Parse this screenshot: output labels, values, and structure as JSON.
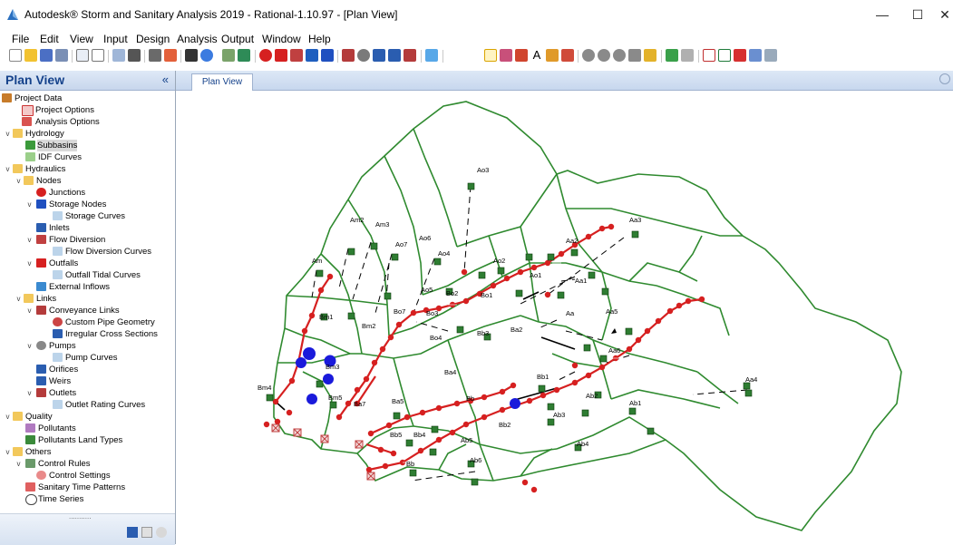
{
  "window": {
    "title": "Autodesk® Storm and Sanitary Analysis 2019 - Rational-1.10.97 - [Plan View]",
    "minimize_glyph": "—",
    "maximize_glyph": "☐",
    "close_glyph": "✕"
  },
  "menu": [
    "File",
    "Edit",
    "View",
    "Input",
    "Design",
    "Analysis",
    "Output",
    "Window",
    "Help"
  ],
  "panel": {
    "title": "Plan View",
    "collapse_glyph": "«",
    "footer_handle": "..........."
  },
  "tree": [
    {
      "label": "Project Data",
      "icon": "project-icon"
    },
    {
      "label": "Project Options",
      "icon": "options-icon"
    },
    {
      "label": "Analysis Options",
      "icon": "analysis-icon"
    },
    {
      "label": "Hydrology",
      "icon": "folder-icon"
    },
    {
      "label": "Subbasins",
      "icon": "subbasin-icon"
    },
    {
      "label": "IDF Curves",
      "icon": "curve-icon"
    },
    {
      "label": "Hydraulics",
      "icon": "folder-icon"
    },
    {
      "label": "Nodes",
      "icon": "folder-icon"
    },
    {
      "label": "Junctions",
      "icon": "junction-icon"
    },
    {
      "label": "Storage Nodes",
      "icon": "storage-icon"
    },
    {
      "label": "Storage Curves",
      "icon": "curve-icon"
    },
    {
      "label": "Inlets",
      "icon": "inlet-icon"
    },
    {
      "label": "Flow Diversion",
      "icon": "diversion-icon"
    },
    {
      "label": "Flow Diversion Curves",
      "icon": "curve-icon"
    },
    {
      "label": "Outfalls",
      "icon": "outfall-icon"
    },
    {
      "label": "Outfall Tidal Curves",
      "icon": "curve-icon"
    },
    {
      "label": "External Inflows",
      "icon": "inflow-icon"
    },
    {
      "label": "Links",
      "icon": "folder-icon"
    },
    {
      "label": "Conveyance Links",
      "icon": "pipe-icon"
    },
    {
      "label": "Custom Pipe Geometry",
      "icon": "pipe-geometry-icon"
    },
    {
      "label": "Irregular Cross Sections",
      "icon": "cross-section-icon"
    },
    {
      "label": "Pumps",
      "icon": "pump-icon"
    },
    {
      "label": "Pump Curves",
      "icon": "curve-icon"
    },
    {
      "label": "Orifices",
      "icon": "orifice-icon"
    },
    {
      "label": "Weirs",
      "icon": "weir-icon"
    },
    {
      "label": "Outlets",
      "icon": "outlet-icon"
    },
    {
      "label": "Outlet Rating Curves",
      "icon": "curve-icon"
    },
    {
      "label": "Quality",
      "icon": "folder-icon"
    },
    {
      "label": "Pollutants",
      "icon": "pollutant-icon"
    },
    {
      "label": "Pollutants Land Types",
      "icon": "landtype-icon"
    },
    {
      "label": "Others",
      "icon": "folder-icon"
    },
    {
      "label": "Control Rules",
      "icon": "rules-icon"
    },
    {
      "label": "Control Settings",
      "icon": "settings-icon"
    },
    {
      "label": "Sanitary Time Patterns",
      "icon": "pattern-icon"
    },
    {
      "label": "Time Series",
      "icon": "clock-icon"
    }
  ],
  "tabs": [
    "Plan View"
  ],
  "map": {
    "subbasin_labels": [
      "Ao3",
      "Am2",
      "Am3",
      "Ao7",
      "Ao6",
      "Ao4",
      "Ao2",
      "Ao1",
      "Aa3",
      "Aa2",
      "Am",
      "Ao5",
      "Bo2",
      "Bo1",
      "Aa1",
      "Aa5",
      "Bm1",
      "Bm2",
      "Bo7",
      "Bo3",
      "Aa",
      "Bo4",
      "Bb3",
      "Ba2",
      "Aa6",
      "Aa4",
      "Bm3",
      "Ba4",
      "Bb1",
      "Bm4",
      "Bm5",
      "Ba5",
      "Bb",
      "Ab2",
      "Ab1",
      "Ba7",
      "Ab3",
      "Bb2",
      "Bb5",
      "Bb4",
      "Ab5",
      "Ab4",
      "Bb",
      "Ab6"
    ],
    "colors": {
      "boundary": "#2f8a2f",
      "junction": "#d62020",
      "storage": "#1a1adb",
      "pipe": "#000000"
    }
  }
}
